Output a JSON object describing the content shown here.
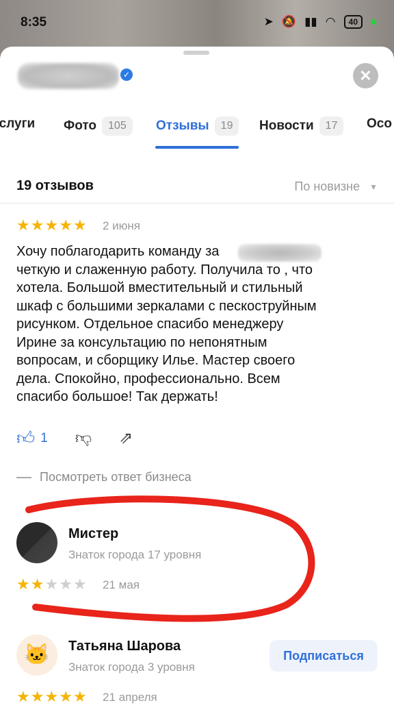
{
  "status_bar": {
    "time": "8:35",
    "battery": "40",
    "icons": [
      "location-icon",
      "mute-icon",
      "signal-icon",
      "wifi-icon",
      "battery-icon"
    ]
  },
  "header": {
    "close_symbol": "✕",
    "verified_symbol": "✓"
  },
  "tabs": [
    {
      "label": "Услуги",
      "count": ""
    },
    {
      "label": "Фото",
      "count": "105"
    },
    {
      "label": "Отзывы",
      "count": "19"
    },
    {
      "label": "Новости",
      "count": "17"
    },
    {
      "label": "Осо",
      "count": ""
    }
  ],
  "reviews": {
    "total_label": "19 отзывов",
    "sort_label": "По новизне",
    "sort_caret": "▼"
  },
  "review1": {
    "rating": 5,
    "date": "2 июня",
    "text": "Хочу поблагодарить команду                     за\nчеткую и слаженную работу. Получила то , что\nхотела. Большой вместительный и стильный\nшкаф с большими зеркалами с пескоструйным\nрисунком. Отдельное спасибо менеджеру\nИрине за консультацию по непонятным\nвопросам, и сборщику Илье. Мастер своего\nдела. Спокойно, профессионально.  Всем\nспасибо большое! Так держать!",
    "likes": "1",
    "business_reply_label": "Посмотреть ответ бизнеса"
  },
  "review2": {
    "author": "Мистер",
    "level": "Знаток города 17 уровня",
    "rating": 2,
    "date": "21 мая"
  },
  "review3": {
    "author": "Татьяна Шарова",
    "level": "Знаток города 3 уровня",
    "subscribe_label": "Подписаться",
    "rating": 5,
    "date": "21 апреля"
  },
  "colors": {
    "accent": "#2f6fd9",
    "star": "#f5b400",
    "annotation": "#e8241b"
  }
}
